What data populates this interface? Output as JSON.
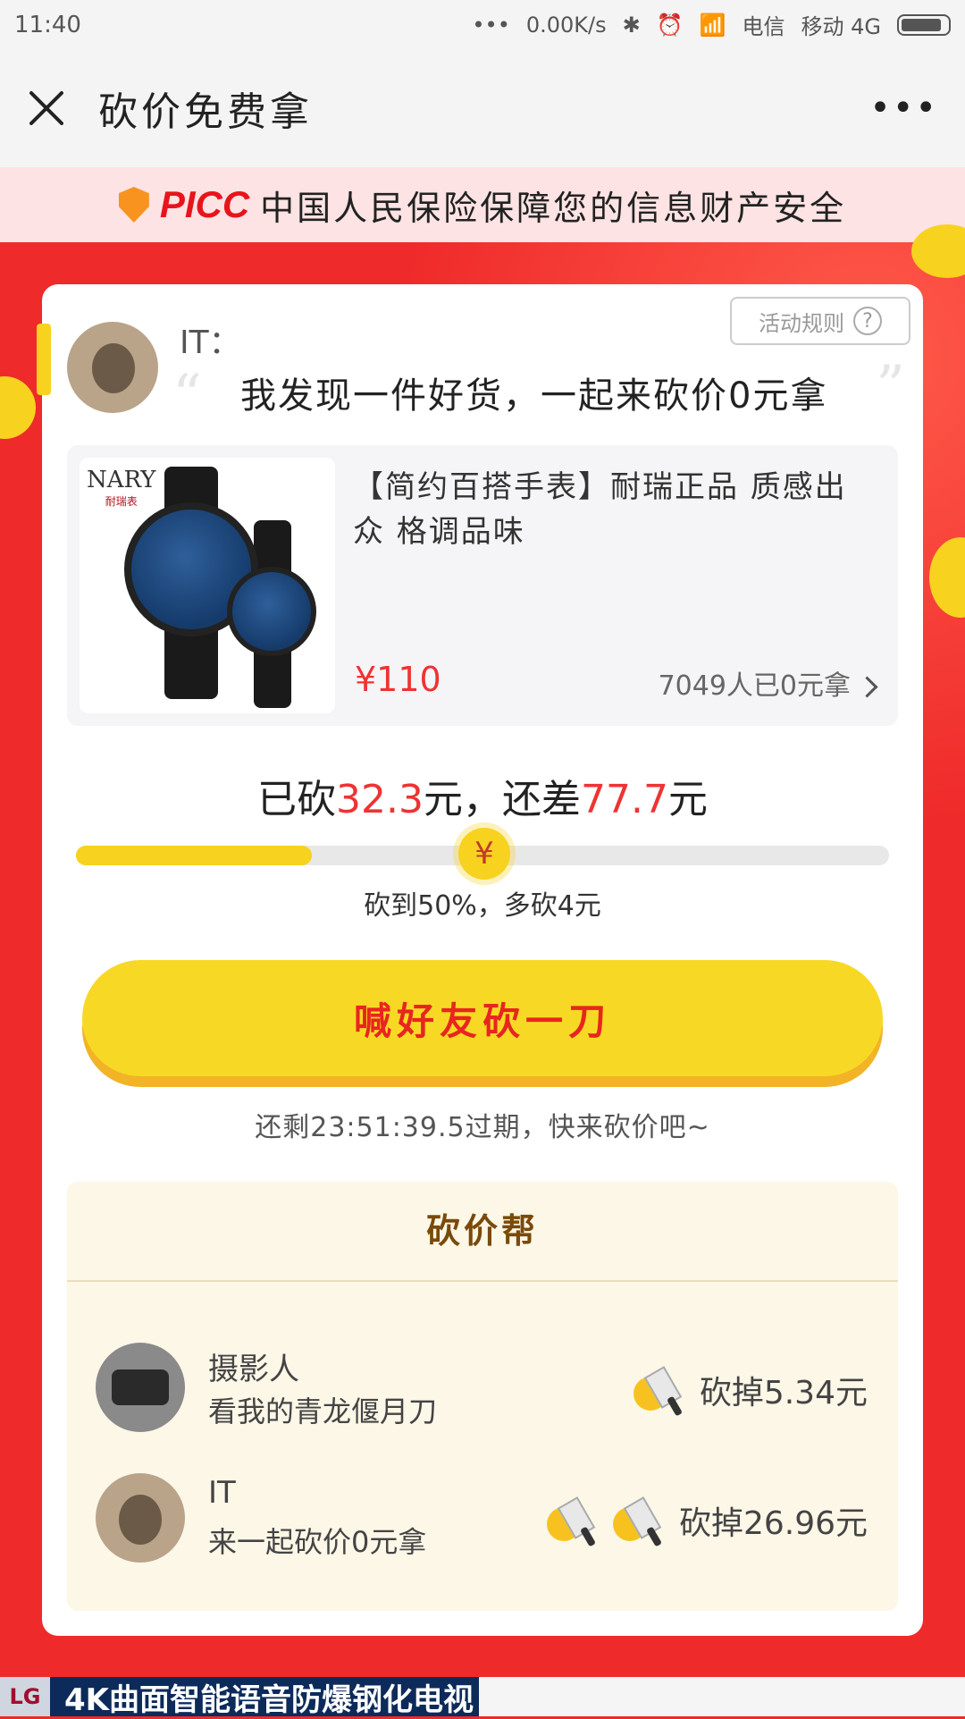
{
  "status_bar": {
    "time": "11:40",
    "network_speed": "0.00K/s",
    "carrier1": "电信",
    "carrier2": "移动 4G"
  },
  "nav": {
    "title": "砍价免费拿",
    "more_label": "•••"
  },
  "banner": {
    "logo": "PICC",
    "text": "中国人民保险保障您的信息财产安全"
  },
  "share": {
    "username": "IT：",
    "rules_label": "活动规则",
    "message": "我发现一件好货，一起来砍价0元拿",
    "quote_open": "“",
    "quote_close": "”"
  },
  "product": {
    "brand": "NARY",
    "brand_sub": "耐瑞表",
    "title": "【简约百搭手表】耐瑞正品 质感出众 格调品味",
    "price": "¥110",
    "taken_count": "7049人已0元拿"
  },
  "progress": {
    "prefix": "已砍",
    "cut_amount": "32.3",
    "middle": "元，还差",
    "remaining_amount": "77.7",
    "suffix": "元",
    "fill_fraction": 0.29,
    "marker_symbol": "¥",
    "milestone_text": "砍到50%，多砍4元"
  },
  "cta": {
    "label": "喊好友砍一刀",
    "countdown": "还剩23:51:39.5过期，快来砍价吧~"
  },
  "helpers": {
    "title": "砍价帮",
    "list": [
      {
        "name": "摄影人",
        "note": "看我的青龙偃月刀",
        "amount": "砍掉5.34元",
        "icons": 1
      },
      {
        "name": "IT",
        "note": "来一起砍价0元拿",
        "amount": "砍掉26.96元",
        "icons": 2
      }
    ]
  },
  "bottom_ad": {
    "brand": "LG",
    "text": "4K曲面智能语音防爆钢化电视"
  },
  "colors": {
    "accent_red": "#e33333",
    "accent_yellow": "#f7d21f",
    "background_red": "#ef2a2a"
  }
}
